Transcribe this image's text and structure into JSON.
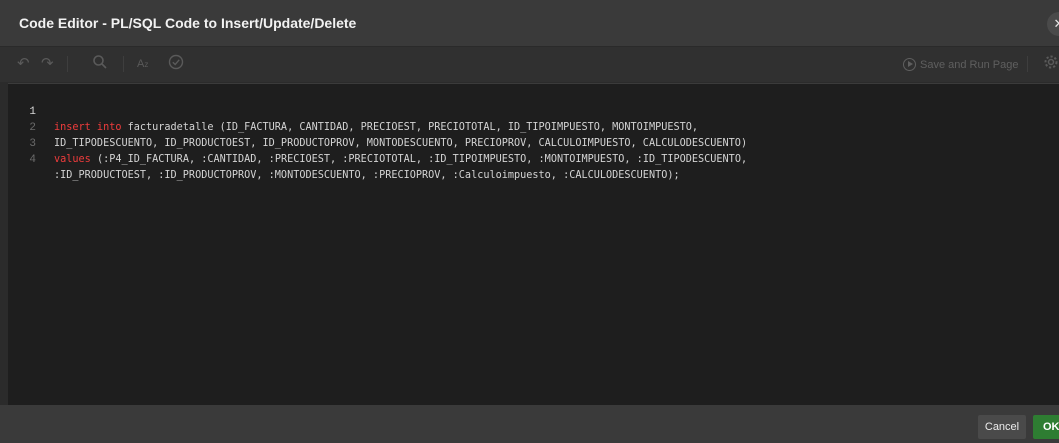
{
  "dialog": {
    "title": "Code Editor - PL/SQL Code to Insert/Update/Delete",
    "close_icon": "close-icon"
  },
  "toolbar": {
    "undo_icon": "undo-icon",
    "redo_icon": "redo-icon",
    "search_icon": "search-icon",
    "autocomplete_icon": "autocomplete-icon",
    "validate_icon": "validate-icon",
    "save_run_label": "Save and Run Page",
    "settings_icon": "gear-icon"
  },
  "editor": {
    "lines": [
      {
        "num": "1",
        "keyword": "insert into",
        "text": " facturadetalle (ID_FACTURA, CANTIDAD, PRECIOEST, PRECIOTOTAL, ID_TIPOIMPUESTO, MONTOIMPUESTO,"
      },
      {
        "num": "2",
        "keyword": "",
        "text": "ID_TIPODESCUENTO, ID_PRODUCTOEST, ID_PRODUCTOPROV, MONTODESCUENTO, PRECIOPROV, CALCULOIMPUESTO, CALCULODESCUENTO)"
      },
      {
        "num": "3",
        "keyword": "values",
        "text": " (:P4_ID_FACTURA, :CANTIDAD, :PRECIOEST, :PRECIOTOTAL, :ID_TIPOIMPUESTO, :MONTOIMPUESTO, :ID_TIPODESCUENTO,"
      },
      {
        "num": "4",
        "keyword": "",
        "text": ":ID_PRODUCTOEST, :ID_PRODUCTOPROV, :MONTODESCUENTO, :PRECIOPROV, :Calculoimpuesto, :CALCULODESCUENTO);"
      }
    ]
  },
  "footer": {
    "cancel_label": "Cancel",
    "ok_label": "OK"
  },
  "colors": {
    "keyword": "#ef3c3c",
    "ok_button": "#2e7d32"
  }
}
